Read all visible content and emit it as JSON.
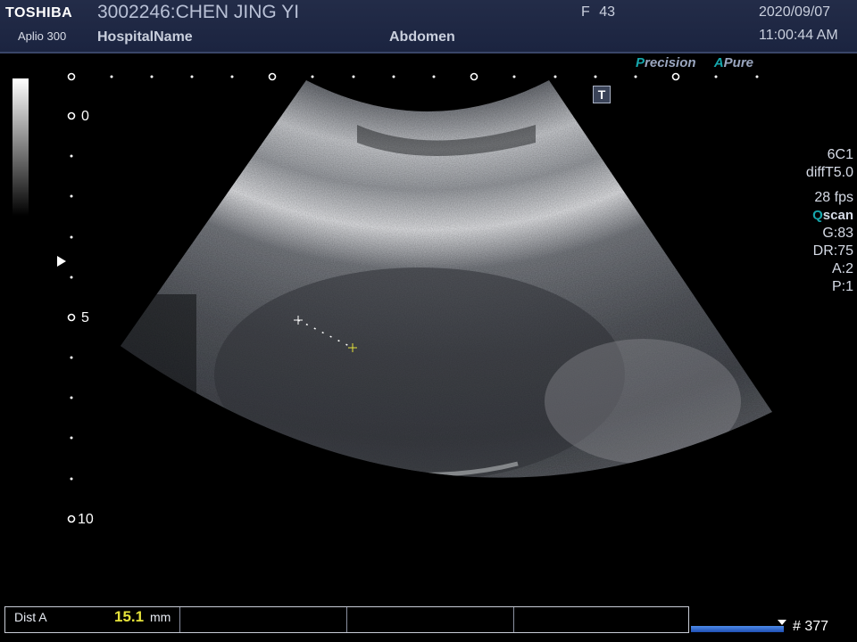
{
  "header": {
    "brand": "TOSHIBA",
    "model": "Aplio 300",
    "patient": "3002246:CHEN JING YI",
    "hospital": "HospitalName",
    "sex": "F",
    "age": "43",
    "exam": "Abdomen",
    "date": "2020/09/07",
    "time": "11:00:44 AM"
  },
  "processing": {
    "precision_p": "P",
    "precision_rest": "recision",
    "apure_a": "A",
    "apure_rest": "Pure"
  },
  "t_icon": "T",
  "depth_scale": {
    "labels": [
      "0",
      "5",
      "10"
    ]
  },
  "params": {
    "probe": "6C1",
    "mode": "diffT5.0",
    "fps": "28 fps",
    "qscan_q": "Q",
    "qscan_rest": "scan",
    "gain": "G:83",
    "dr": "DR:75",
    "a": "A:2",
    "p": "P:1"
  },
  "measurement": {
    "label": "Dist A",
    "value": "15.1",
    "unit": "mm"
  },
  "cine": {
    "frame_text": "# 377"
  },
  "colors": {
    "header_bg": "#1e2744",
    "accent_teal": "#16a7ad",
    "measure_yellow": "#e5e23a",
    "cine_blue": "#2f6bd6"
  }
}
